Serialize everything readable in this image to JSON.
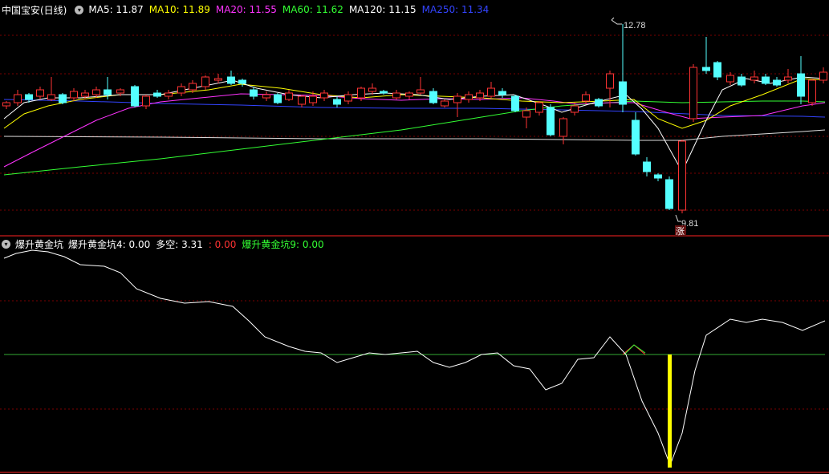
{
  "top": {
    "title": "中国宝安(日线)",
    "ma": [
      {
        "label": "MA5: 11.87",
        "color": "#ffffff"
      },
      {
        "label": "MA10: 11.89",
        "color": "#ffff00"
      },
      {
        "label": "MA20: 11.55",
        "color": "#ff33ff"
      },
      {
        "label": "MA60: 11.62",
        "color": "#33ff33"
      },
      {
        "label": "MA120: 11.15",
        "color": "#ffffff"
      },
      {
        "label": "MA250: 11.34",
        "color": "#3344ff"
      }
    ],
    "high_label": "12.78",
    "low_label": "9.81",
    "zhang_label": "涨"
  },
  "bottom": {
    "title": "爆升黄金坑",
    "items": [
      {
        "label": "爆升黄金坑4: 0.00",
        "color": "#ffffff"
      },
      {
        "label": "多空: 3.31",
        "color": "#ffffff"
      },
      {
        "label": ": 0.00",
        "color": "#ff3333"
      },
      {
        "label": "爆升黄金坑9: 0.00",
        "color": "#33ff33"
      }
    ]
  },
  "colors": {
    "up": "#ff3333",
    "down": "#54ffff",
    "grid": "#7a0000",
    "border": "#ff2222",
    "zero_line": "#33aa33",
    "bar": "#ffff00"
  }
}
